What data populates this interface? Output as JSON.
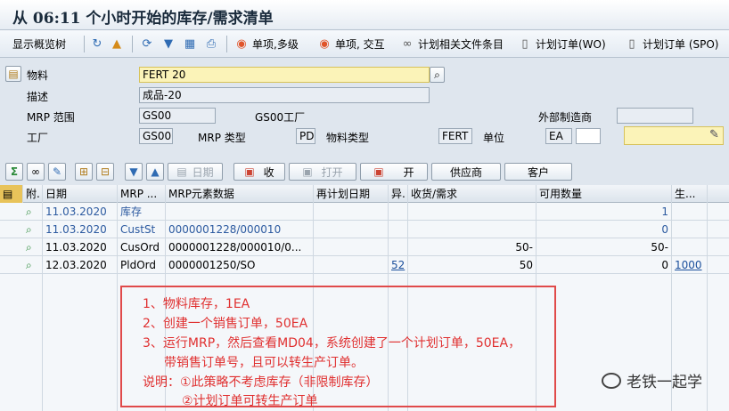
{
  "window": {
    "title": "从 06:11 个小时开始的库存/需求清单"
  },
  "toolbar": {
    "overview_tree": "显示概览树",
    "single_multi": "单项,多级",
    "single_interactive": "单项, 交互",
    "plan_file_items": "计划相关文件条目",
    "planned_order_wo": "计划订单(WO)",
    "planned_order_spo": "计划订单 (SPO)"
  },
  "header": {
    "material_label": "物料",
    "material_value": "FERT 20",
    "desc_label": "描述",
    "desc_value": "成品-20",
    "mrp_area_label": "MRP 范围",
    "mrp_area_value": "GS00",
    "mrp_area_name": "GS00工厂",
    "ext_proc_label": "外部制造商",
    "plant_label": "工厂",
    "plant_value": "GS00",
    "mrp_type_label": "MRP 类型",
    "mrp_type_value": "PD",
    "mat_type_label": "物料类型",
    "mat_type_value": "FERT",
    "unit_label": "单位",
    "unit_value": "EA"
  },
  "buttons": {
    "date": "日期",
    "receipts": "收",
    "open": "打开",
    "open2": "开",
    "vendor": "供应商",
    "customer": "客户"
  },
  "table": {
    "headers": [
      "附.",
      "日期",
      "MRP ...",
      "MRP元素数据",
      "再计划日期",
      "异.",
      "收货/需求",
      "可用数量",
      "生..."
    ],
    "rows": [
      {
        "date": "11.03.2020",
        "elem": "库存",
        "data": "",
        "resched": "",
        "exc": "",
        "qty": "",
        "avail": "1",
        "prod": "",
        "blue": true
      },
      {
        "date": "11.03.2020",
        "elem": "CustSt",
        "data": "0000001228/000010",
        "resched": "",
        "exc": "",
        "qty": "",
        "avail": "0",
        "prod": "",
        "blue": true
      },
      {
        "date": "11.03.2020",
        "elem": "CusOrd",
        "data": "0000001228/000010/0...",
        "resched": "",
        "exc": "",
        "qty": "50-",
        "avail": "50-",
        "prod": "",
        "blue": false
      },
      {
        "date": "12.03.2020",
        "elem": "PldOrd",
        "data": "0000001250/SO",
        "resched": "",
        "exc": "52",
        "qty": "50",
        "avail": "0",
        "prod": "1000",
        "blue": false
      }
    ]
  },
  "annotation": {
    "line1": "1、物料库存，1EA",
    "line2": "2、创建一个销售订单，50EA",
    "line3": "3、运行MRP，然后查看MD04，系统创建了一个计划订单，50EA，",
    "line4": "带销售订单号，且可以转生产订单。",
    "line5": "说明：①此策略不考虑库存（非限制库存）",
    "line6": "②计划订单可转生产订单",
    "color": "#e03030"
  },
  "watermark": {
    "text": "老铁一起学"
  }
}
